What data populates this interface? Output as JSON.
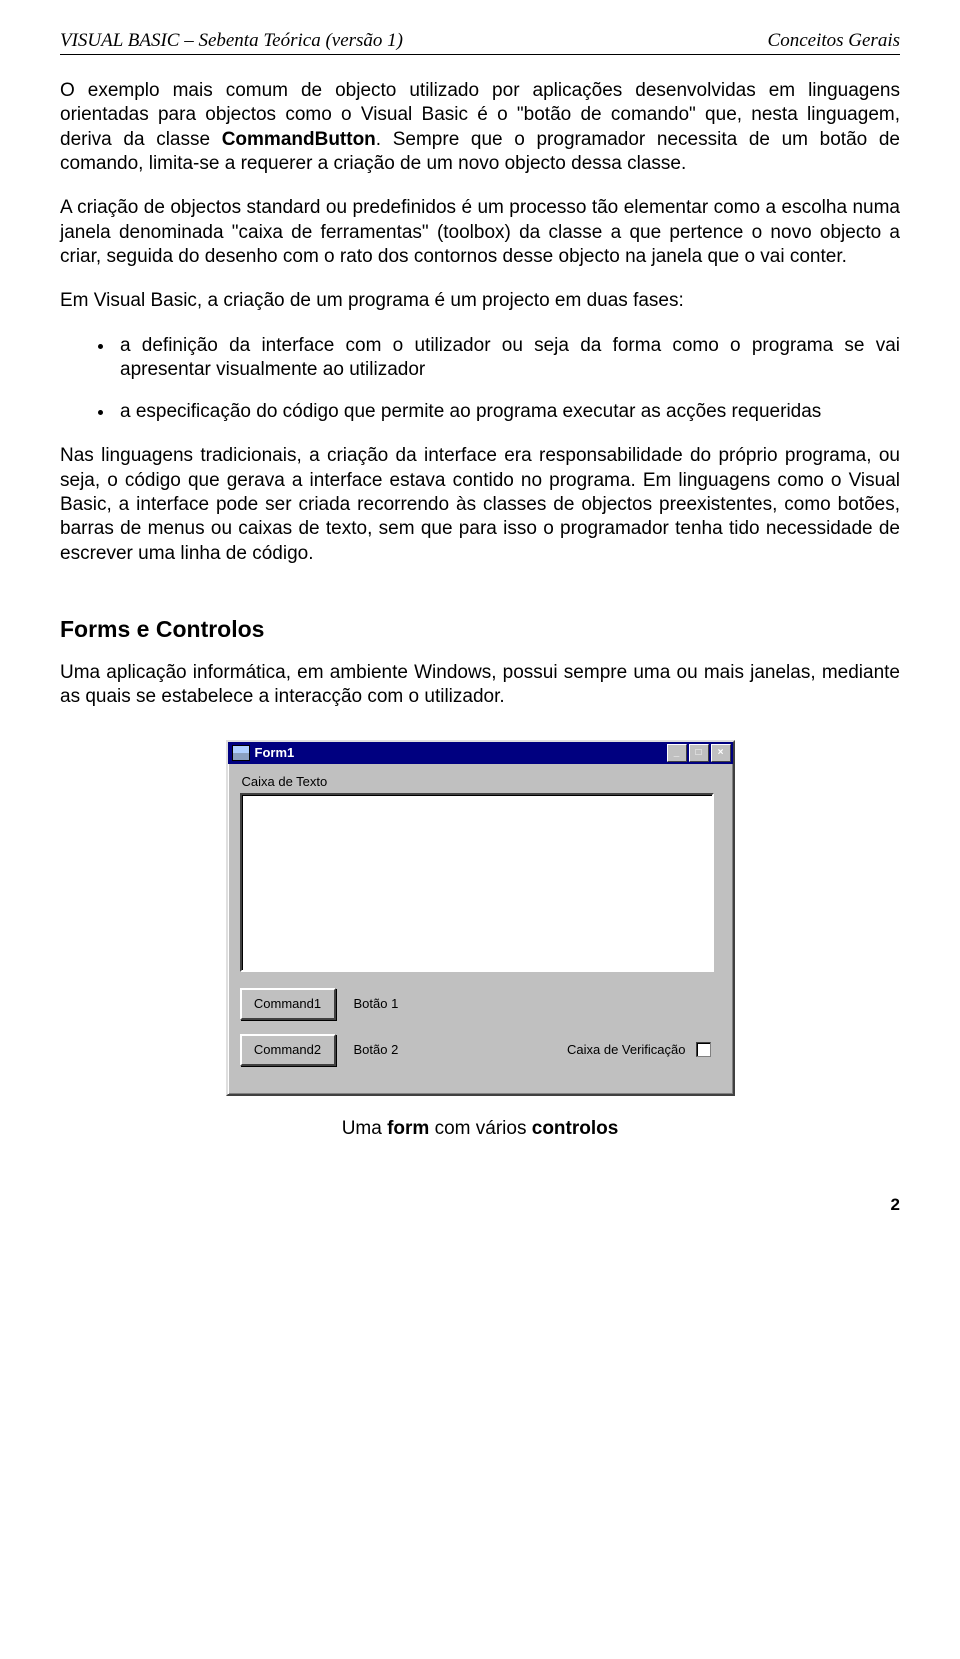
{
  "header": {
    "left": "VISUAL BASIC – Sebenta Teórica (versão 1)",
    "right": "Conceitos Gerais"
  },
  "p1a": "O exemplo mais comum de objecto utilizado por aplicações desenvolvidas em linguagens orientadas para objectos como o Visual Basic é o \"botão de comando\" que, nesta linguagem, deriva da classe ",
  "p1b": "CommandButton",
  "p1c": ". Sempre que o programador necessita de um botão de comando, limita-se a requerer a criação de um novo objecto dessa classe.",
  "p2": "A criação de objectos standard ou predefinidos é um processo tão elementar como a escolha numa janela denominada \"caixa de ferramentas\" (toolbox) da classe a que pertence o novo objecto a criar, seguida do desenho com o rato dos contornos desse objecto na janela que o vai conter.",
  "p3": "Em Visual Basic,  a criação de um programa é um projecto em duas fases:",
  "bullets": [
    "a definição da interface com o utilizador ou seja da forma como o programa se vai apresentar visualmente ao utilizador",
    "a especificação do código que permite ao programa executar as acções requeridas"
  ],
  "p4": "Nas linguagens tradicionais, a criação da interface era responsabilidade do próprio programa, ou seja, o código que gerava a interface estava contido no programa. Em linguagens como o Visual Basic, a interface pode ser criada recorrendo às classes de objectos preexistentes, como botões, barras de menus ou caixas de texto, sem que para isso o programador tenha tido necessidade de escrever uma linha de código.",
  "h2": "Forms e Controlos",
  "p5": "Uma aplicação informática, em ambiente Windows, possui sempre uma ou mais janelas, mediante as quais se estabelece a interacção com o utilizador.",
  "window": {
    "title": "Form1",
    "label_textbox": "Caixa de Texto",
    "btn1": "Command1",
    "btn1_label": "Botão 1",
    "btn2": "Command2",
    "btn2_label": "Botão 2",
    "checkbox_label": "Caixa de Verificação",
    "min_glyph": "_",
    "max_glyph": "□",
    "close_glyph": "×"
  },
  "caption_a": "Uma ",
  "caption_b": "form",
  "caption_c": " com vários ",
  "caption_d": "controlos",
  "page_number": "2"
}
